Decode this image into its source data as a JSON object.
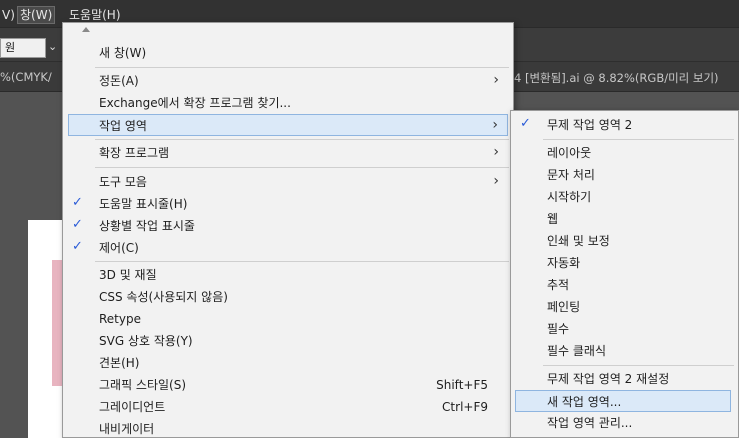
{
  "menubar": {
    "items": [
      {
        "label": "V)"
      },
      {
        "label": "창(W)"
      },
      {
        "label": "도움말(H)"
      }
    ]
  },
  "controlbar": {
    "shape_value": "원"
  },
  "doc_tabs": {
    "left": "%(CMYK/",
    "right": "4 [변환됨].ai @ 8.82%(RGB/미리 보기)"
  },
  "main_menu": {
    "items": [
      {
        "label": "새 창(W)"
      },
      {
        "label": "정돈(A)"
      },
      {
        "label": "Exchange에서 확장 프로그램 찾기..."
      },
      {
        "label": "작업 영역"
      },
      {
        "label": "확장 프로그램"
      },
      {
        "label": "도구 모음"
      },
      {
        "label": "도움말 표시줄(H)"
      },
      {
        "label": "상황별 작업 표시줄"
      },
      {
        "label": "제어(C)"
      },
      {
        "label": "3D 및 재질"
      },
      {
        "label": "CSS 속성(사용되지 않음)"
      },
      {
        "label": "Retype"
      },
      {
        "label": "SVG 상호 작용(Y)"
      },
      {
        "label": "견본(H)"
      },
      {
        "label": "그래픽 스타일(S)",
        "shortcut": "Shift+F5"
      },
      {
        "label": "그레이디언트",
        "shortcut": "Ctrl+F9"
      },
      {
        "label": "내비게이터"
      }
    ]
  },
  "sub_menu": {
    "items": [
      {
        "label": "무제 작업 영역 2"
      },
      {
        "label": "레이아웃"
      },
      {
        "label": "문자 처리"
      },
      {
        "label": "시작하기"
      },
      {
        "label": "웹"
      },
      {
        "label": "인쇄 및 보정"
      },
      {
        "label": "자동화"
      },
      {
        "label": "추적"
      },
      {
        "label": "페인팅"
      },
      {
        "label": "필수"
      },
      {
        "label": "필수 클래식"
      },
      {
        "label": "무제 작업 영역 2 재설정"
      },
      {
        "label": "새 작업 영역..."
      },
      {
        "label": "작업 영역 관리..."
      }
    ]
  },
  "icons": {
    "check": "✓",
    "submenu_arrow": "›",
    "dropdown_chevron": "⌄"
  },
  "colors": {
    "menu_bg": "#f2f2f2",
    "highlight_bg": "#dbe9f8",
    "check": "#2a5bd7"
  }
}
